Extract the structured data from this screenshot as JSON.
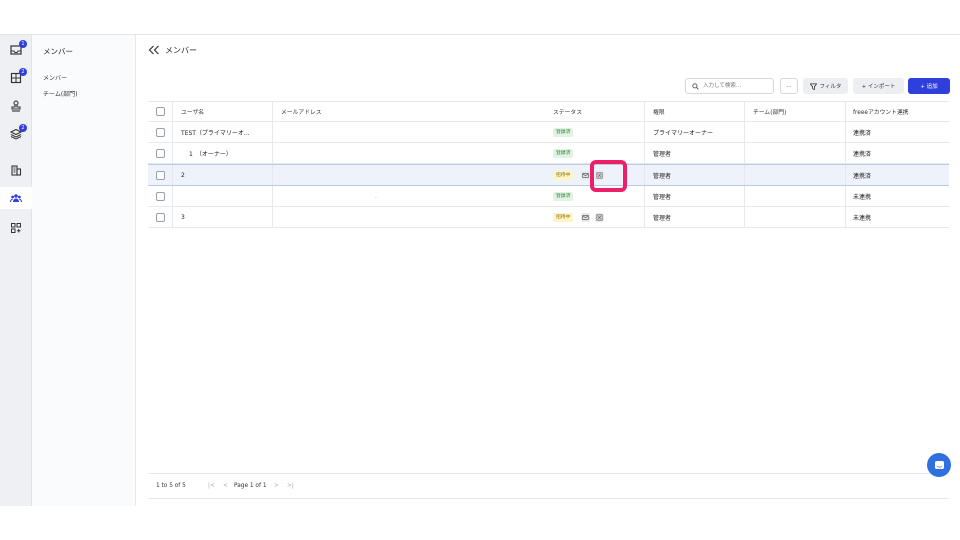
{
  "rail": {
    "badges": [
      "1",
      "2",
      "2"
    ],
    "icons": [
      "inbox-icon",
      "building-icon",
      "stamp-icon",
      "layers-icon",
      "office-icon",
      "team-icon",
      "apps-icon"
    ]
  },
  "subnav": {
    "title": "メンバー",
    "items": [
      {
        "label": "メンバー"
      },
      {
        "label": "チーム(部門)"
      }
    ]
  },
  "header": {
    "title": "メンバー"
  },
  "toolbar": {
    "search_placeholder": "入力して検索...",
    "more_label": "...",
    "filter_label": "フィルタ",
    "import_label": "+ インポート",
    "add_label": "+ 追加"
  },
  "table": {
    "columns": [
      "ユーザ名",
      "メールアドレス",
      "ステータス",
      "権限",
      "チーム(部門)",
      "freeeアカウント連携"
    ],
    "rows": [
      {
        "name": "TEST（プライマリーオ...",
        "email": "",
        "status": "登録済",
        "role": "プライマリーオーナー",
        "team": "",
        "freee": "連携済"
      },
      {
        "name": "1　（オーナー）",
        "email": "",
        "status": "登録済",
        "role": "管理者",
        "team": "",
        "freee": "連携済"
      },
      {
        "name": "2",
        "email": "",
        "status": "招待中",
        "role": "管理者",
        "team": "",
        "freee": "連携済"
      },
      {
        "name": "",
        "email": ".",
        "status": "登録済",
        "role": "管理者",
        "team": "",
        "freee": "未連携"
      },
      {
        "name": "3",
        "email": "",
        "status": "招待中",
        "role": "管理者",
        "team": "",
        "freee": "未連携"
      }
    ]
  },
  "pager": {
    "range": "1 to 5 of 5",
    "page": "Page 1 of 1",
    "first": "|<",
    "prev": "<",
    "next": ">",
    "last": ">|"
  },
  "colors": {
    "accent": "#2f3fdc",
    "highlight": "#ee1f69",
    "tag_registered": "#dff5e2",
    "tag_invited": "#fdf4c8"
  }
}
